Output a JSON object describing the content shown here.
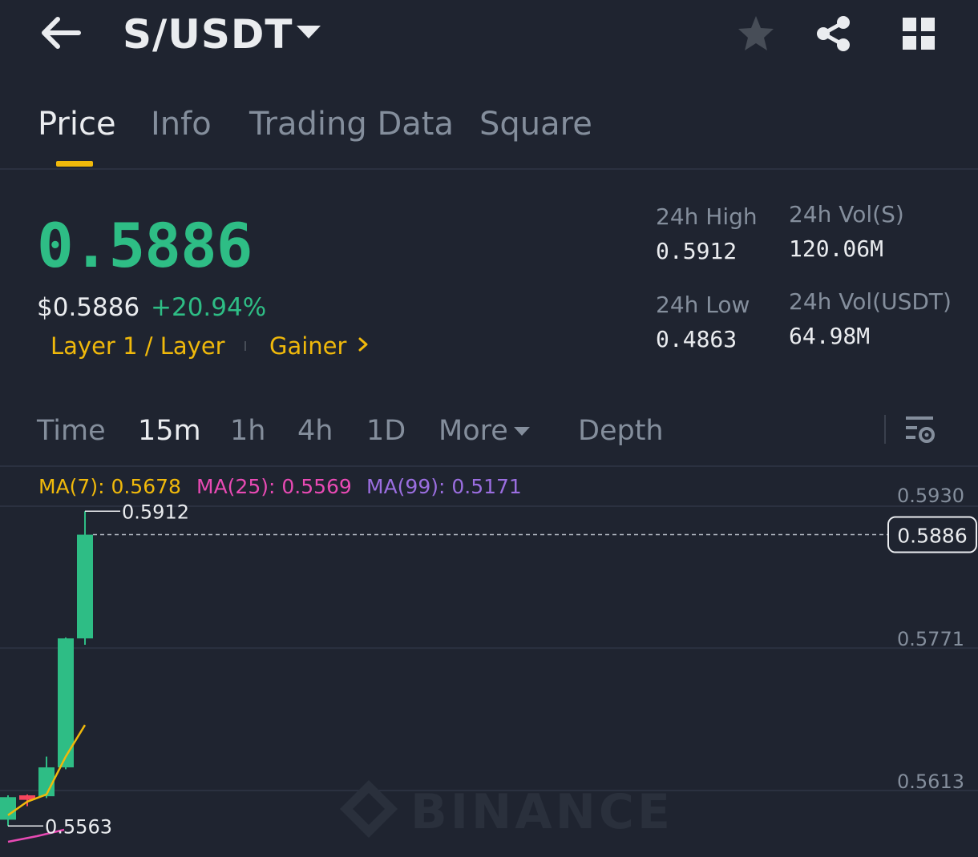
{
  "header": {
    "pair": "S/USDT",
    "icons": [
      "back-arrow-icon",
      "chevron-down-icon",
      "star-icon",
      "share-icon",
      "grid-icon"
    ]
  },
  "tabs": [
    {
      "label": "Price",
      "active": true
    },
    {
      "label": "Info",
      "active": false
    },
    {
      "label": "Trading Data",
      "active": false
    },
    {
      "label": "Square",
      "active": false
    }
  ],
  "ticker": {
    "last_price": "0.5886",
    "usd_price": "$0.5886",
    "change_pct": "+20.94%",
    "tags": [
      "Layer 1 / Layer",
      "Gainer"
    ],
    "stats": {
      "high_label": "24h High",
      "high": "0.5912",
      "low_label": "24h Low",
      "low": "0.4863",
      "vol_base_label": "24h Vol(S)",
      "vol_base": "120.06M",
      "vol_quote_label": "24h Vol(USDT)",
      "vol_quote": "64.98M"
    }
  },
  "intervals": [
    {
      "label": "Time",
      "active": false
    },
    {
      "label": "15m",
      "active": true
    },
    {
      "label": "1h",
      "active": false
    },
    {
      "label": "4h",
      "active": false
    },
    {
      "label": "1D",
      "active": false
    },
    {
      "label": "More",
      "active": false
    },
    {
      "label": "Depth",
      "active": false
    }
  ],
  "ma": {
    "ma7": "MA(7): 0.5678",
    "ma25": "MA(25): 0.5569",
    "ma99": "MA(99): 0.5171"
  },
  "colors": {
    "up": "#2ebd85",
    "down": "#f6465d",
    "accent": "#f0b90b",
    "ma7": "#f0b90b",
    "ma25": "#e84ab4",
    "ma99": "#9b6ee0"
  },
  "watermark": "BINANCE",
  "chart_data": {
    "type": "candlestick",
    "y_ticks": [
      "0.5930",
      "0.5771",
      "0.5613"
    ],
    "y_tick_values": [
      0.593,
      0.5771,
      0.5613
    ],
    "current_price_label": "0.5886",
    "current_price": 0.5886,
    "high_marker": "0.5912",
    "high_value": 0.5912,
    "low_marker": "0.5563",
    "low_value": 0.5563,
    "ylim": [
      0.5545,
      0.596
    ],
    "candles": [
      {
        "o": 0.557,
        "h": 0.5597,
        "l": 0.5563,
        "c": 0.5595
      },
      {
        "o": 0.5596,
        "h": 0.5598,
        "l": 0.5585,
        "c": 0.5592
      },
      {
        "o": 0.5596,
        "h": 0.564,
        "l": 0.5594,
        "c": 0.5628
      },
      {
        "o": 0.5628,
        "h": 0.5772,
        "l": 0.5626,
        "c": 0.5771
      },
      {
        "o": 0.5771,
        "h": 0.5912,
        "l": 0.5764,
        "c": 0.5886
      }
    ],
    "ma7_line": [
      0.5575,
      0.559,
      0.5598,
      0.564,
      0.5675
    ],
    "ma25_line": [
      0.5554,
      0.5558,
      0.5563
    ]
  }
}
